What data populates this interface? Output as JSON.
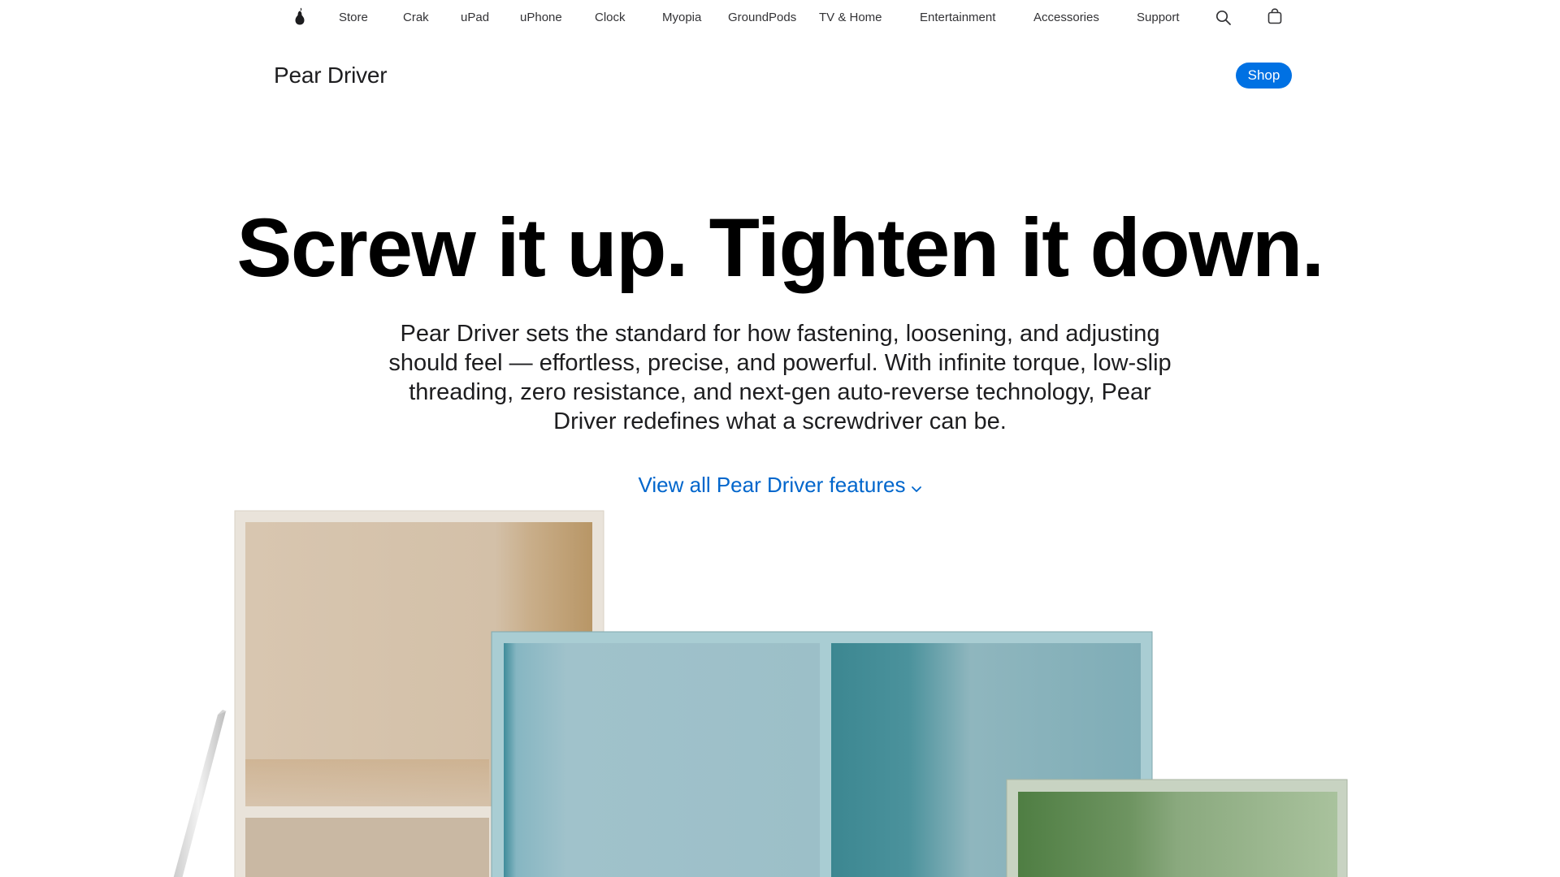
{
  "nav": {
    "logo_icon": "pear-logo-icon",
    "items": [
      {
        "label": "Store"
      },
      {
        "label": "Crak"
      },
      {
        "label": "uPad"
      },
      {
        "label": "uPhone"
      },
      {
        "label": "Clock"
      },
      {
        "label": "Myopia"
      },
      {
        "label": "GroundPods"
      },
      {
        "label": "TV & Home"
      },
      {
        "label": "Entertainment"
      },
      {
        "label": "Accessories"
      },
      {
        "label": "Support"
      }
    ],
    "search_icon": "search-icon",
    "bag_icon": "shopping-bag-icon"
  },
  "local_nav": {
    "title": "Pear Driver",
    "shop_label": "Shop"
  },
  "hero": {
    "headline": "Screw it up. Tighten it down.",
    "intro": "Pear Driver sets the standard for how fastening, loosening, and adjusting should feel — effortless, precise, and powerful. With infinite torque, low-slip threading, zero resistance, and next-gen auto-reverse technology, Pear Driver redefines what a screwdriver can be.",
    "features_link": "View all Pear Driver features"
  },
  "colors": {
    "accent": "#0071e3",
    "link": "#0066cc",
    "text": "#1d1d1f"
  }
}
